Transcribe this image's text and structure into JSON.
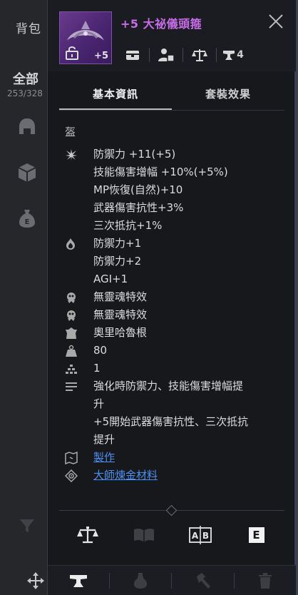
{
  "inventory": {
    "title": "背包",
    "filter_all": "全部",
    "count": "253/328"
  },
  "item": {
    "name": "+5 大祕儀頭箍",
    "thumb_enhance": "+5",
    "name_color": "#c66de8",
    "icon_row": {
      "last_count": "4"
    }
  },
  "tabs": [
    {
      "label": "基本資訊"
    },
    {
      "label": "套裝效果"
    }
  ],
  "category": "盔",
  "stats": [
    {
      "icon": "sparkle-icon",
      "text": "防禦力 +11(+5)"
    },
    {
      "icon": "",
      "text": "技能傷害增幅 +10%(+5%)"
    },
    {
      "icon": "",
      "text": "MP恢復(自然)+10"
    },
    {
      "icon": "",
      "text": "武器傷害抗性+3%"
    },
    {
      "icon": "",
      "text": "三次抵抗+1%"
    },
    {
      "icon": "flame-icon",
      "text": "防禦力+1"
    },
    {
      "icon": "",
      "text": "防禦力+2"
    },
    {
      "icon": "",
      "text": "AGI+1"
    },
    {
      "icon": "soul-icon",
      "text": "無靈魂特效"
    },
    {
      "icon": "soul-icon",
      "text": "無靈魂特效"
    },
    {
      "icon": "crest-icon",
      "text": "奧里哈魯根"
    },
    {
      "icon": "weight-icon",
      "text": "80"
    },
    {
      "icon": "stack-icon",
      "text": "1"
    },
    {
      "icon": "list-icon",
      "text": "強化時防禦力、技能傷害增幅提"
    },
    {
      "icon": "",
      "text": "升"
    },
    {
      "icon": "",
      "text": "+5開始武器傷害抗性、三次抵抗"
    },
    {
      "icon": "",
      "text": "提升"
    },
    {
      "icon": "map-icon",
      "text": "製作",
      "link": true
    },
    {
      "icon": "alchemy-icon",
      "text": "大師煉金材料",
      "link": true
    }
  ],
  "colors": {
    "link": "#4c8ff0",
    "panel": "#17181c"
  }
}
